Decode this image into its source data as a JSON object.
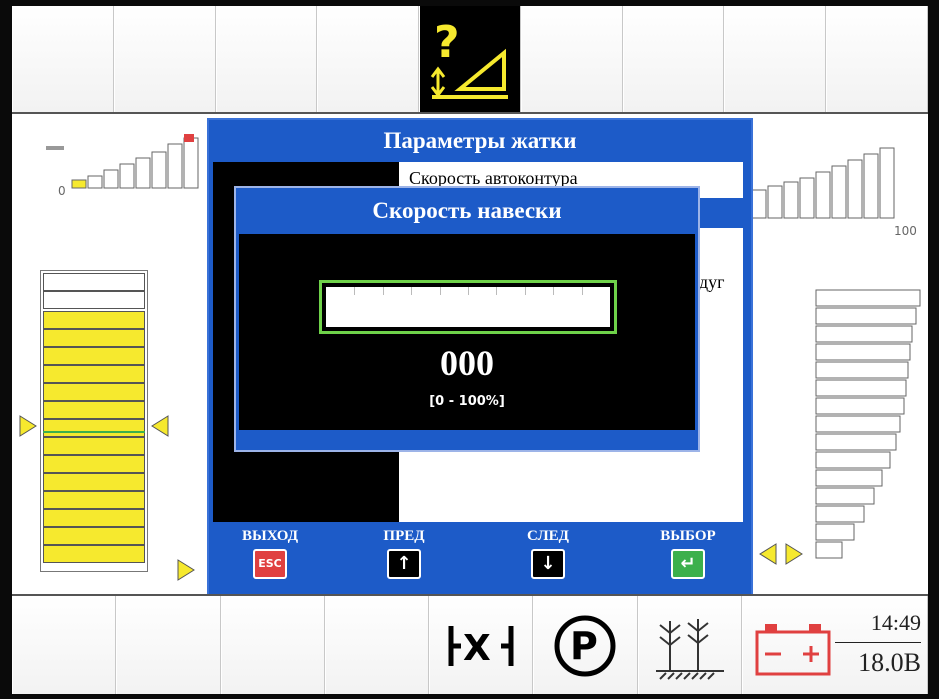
{
  "header_dialog": {
    "title": "Параметры жатки",
    "items": [
      "Скорость автоконтура",
      "",
      "дуг"
    ]
  },
  "modal": {
    "title": "Скорость навески",
    "value": "000",
    "range": "[0 - 100%]",
    "progress_percent": 0
  },
  "footer": {
    "exit": {
      "label": "ВЫХОД",
      "key": "ESC",
      "color": "#e04040"
    },
    "prev": {
      "label": "ПРЕД",
      "key": "↑"
    },
    "next": {
      "label": "СЛЕД",
      "key": "↓"
    },
    "select": {
      "label": "ВЫБОР",
      "key": "↵",
      "color": "#3cb04c"
    }
  },
  "gauges": {
    "left_scale_min": "0",
    "right_scale_max": "100"
  },
  "status": {
    "time": "14:49",
    "voltage": "18.0В"
  },
  "icons": {
    "top_center": "header-help-icon",
    "bottom": [
      "engage-icon",
      "parking-brake-icon",
      "crop-icon",
      "battery-icon"
    ]
  },
  "colors": {
    "accent": "#1d5bc8",
    "highlight": "#6fd24a",
    "warning": "#e04040",
    "indicator": "#f6e92e"
  }
}
